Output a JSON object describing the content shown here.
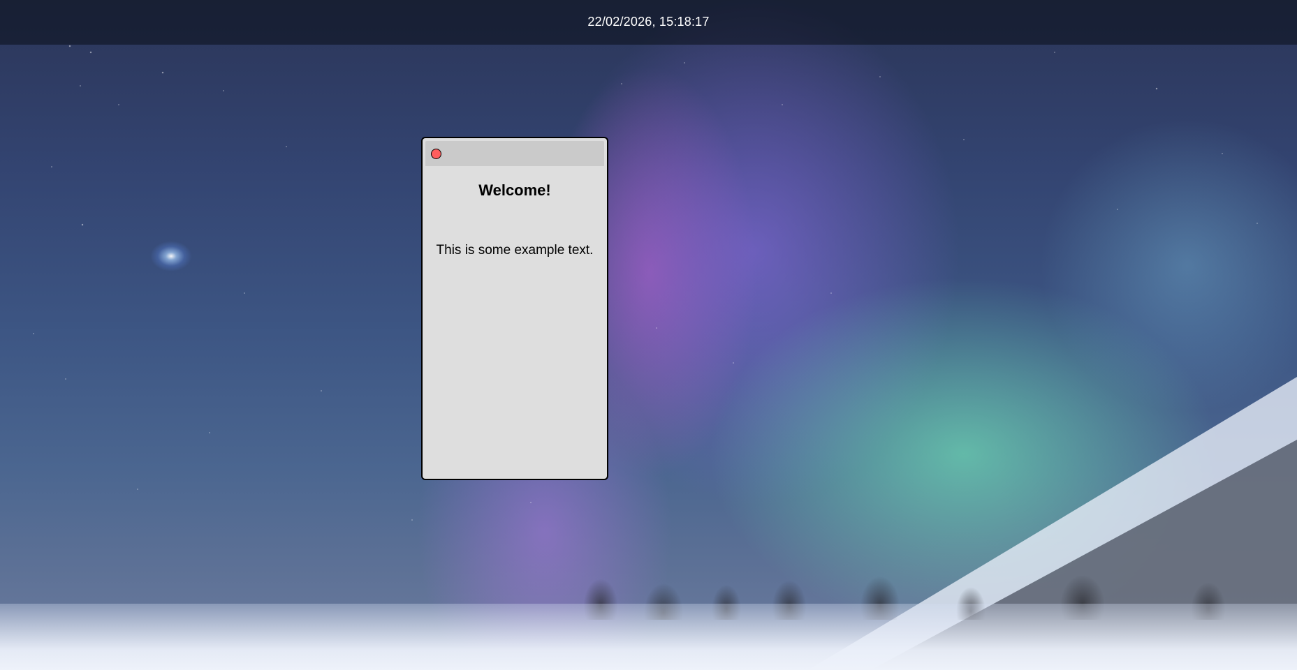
{
  "topbar": {
    "clock": "22/02/2026, 15:18:17"
  },
  "window": {
    "title": "Welcome!",
    "body_text": "This is some example text.",
    "close_icon": "close-icon",
    "close_color": "#ff5d5d"
  },
  "colors": {
    "window_bg": "#dedede",
    "titlebar_bg": "#cacaca",
    "border": "#000000",
    "topbar_text": "#ffffff"
  }
}
